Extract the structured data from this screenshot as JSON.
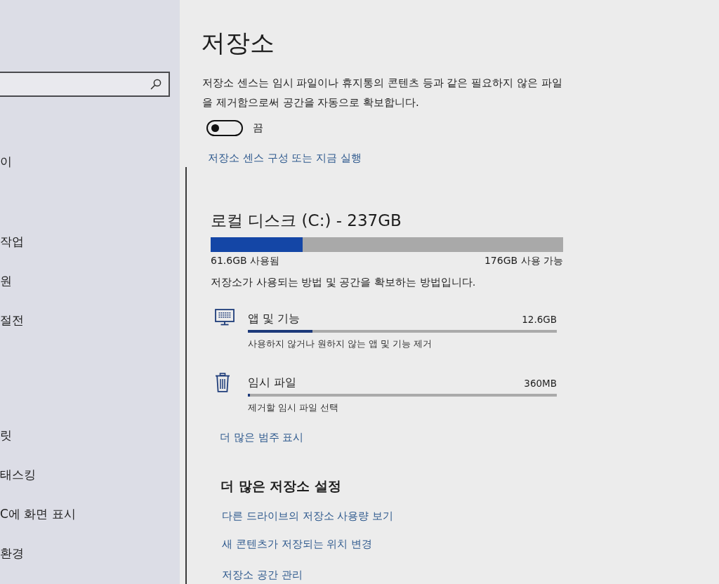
{
  "sidebar": {
    "items": [
      {
        "label": "이"
      },
      {
        "label": "작업"
      },
      {
        "label": "원"
      },
      {
        "label": "절전"
      },
      {
        "label": "릿"
      },
      {
        "label": "태스킹"
      },
      {
        "label": "C에 화면 표시"
      },
      {
        "label": "환경"
      }
    ]
  },
  "page": {
    "title": "저장소",
    "description": "저장소 센스는 임시 파일이나 휴지통의 콘텐츠 등과 같은 필요하지 않은 파일을 제거함으로써 공간을 자동으로 확보합니다."
  },
  "storage_sense": {
    "on": false,
    "state_label": "끔",
    "link": "저장소 센스 구성 또는 지금 실행"
  },
  "disk": {
    "title": "로컬 디스크 (C:) - 237GB",
    "level": 0.26,
    "used": "61.6GB 사용됨",
    "free": "176GB 사용 가능",
    "caption": "저장소가 사용되는 방법 및 공간을 확보하는 방법입니다."
  },
  "categories": [
    {
      "kind": "apps",
      "title": "앱 및 기능",
      "size": "12.6GB",
      "level": 0.21,
      "description": "사용하지 않거나 원하지 않는 앱 및 기능 제거"
    },
    {
      "kind": "temp",
      "title": "임시 파일",
      "size": "360MB",
      "level": 0.007,
      "description": "제거할 임시 파일 선택"
    }
  ],
  "more_categories_link": "더 많은 범주 표시",
  "more_settings": {
    "heading": "더 많은 저장소 설정",
    "links": [
      "다른 드라이브의 저장소 사용량 보기",
      "새 콘텐츠가 저장되는 위치 변경",
      "저장소 공간 관리"
    ]
  }
}
